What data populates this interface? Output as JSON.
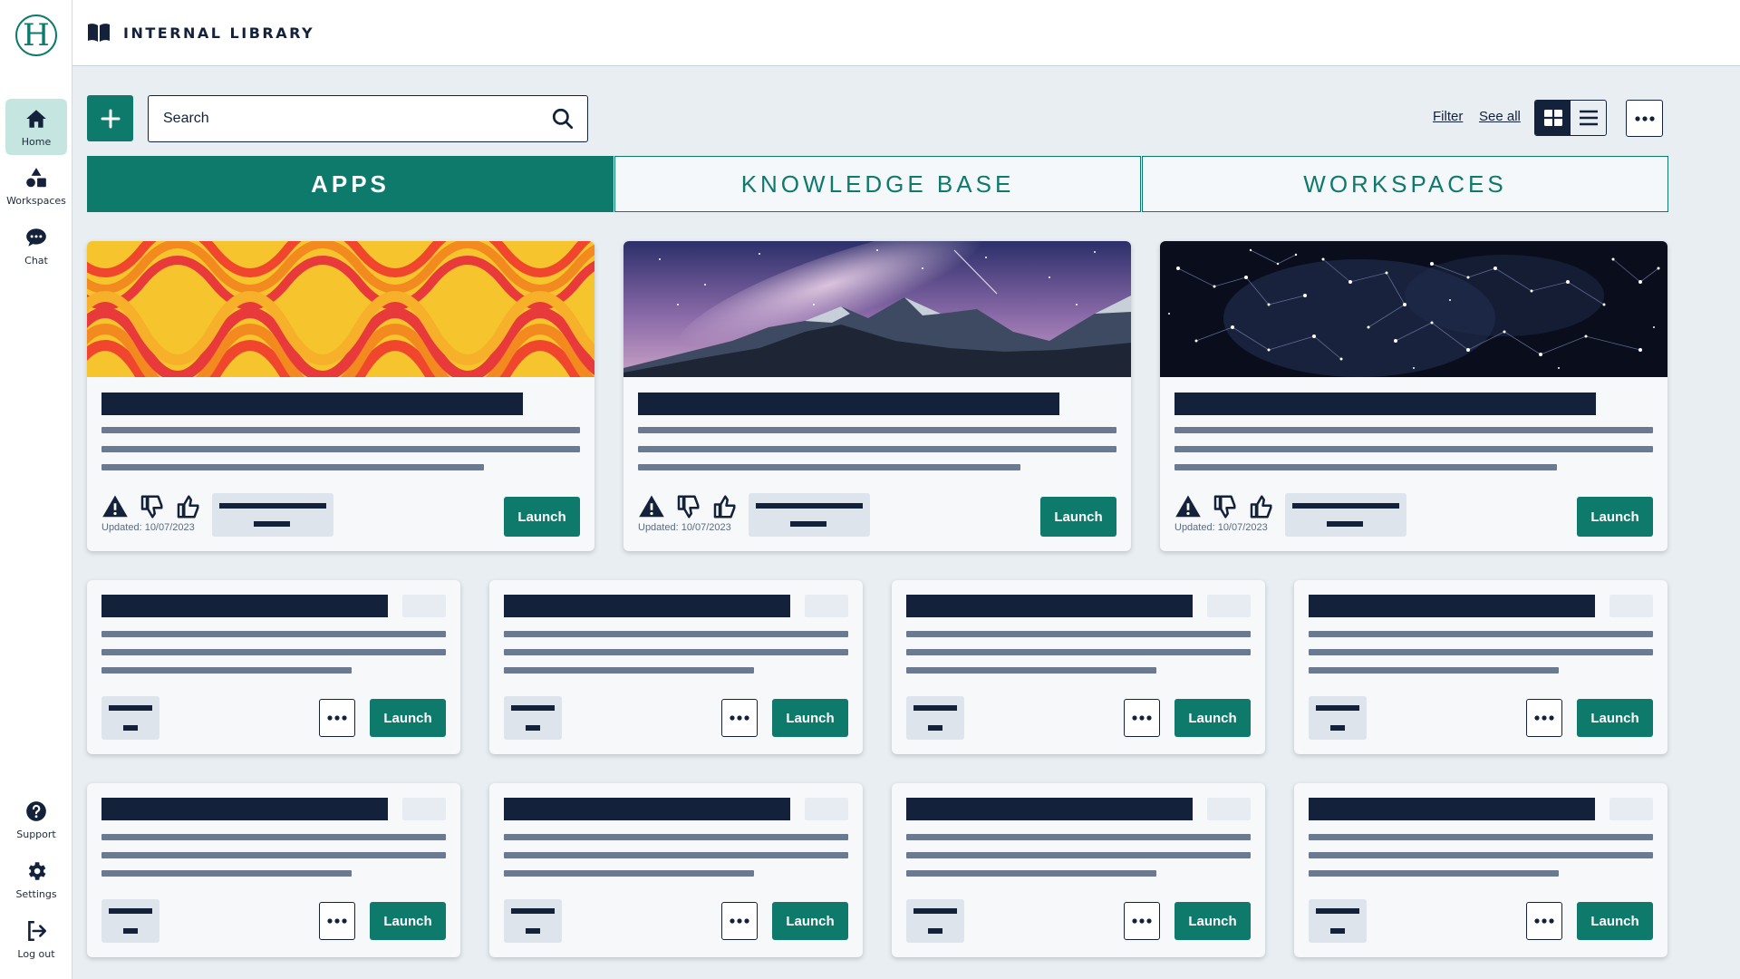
{
  "sidebar": {
    "logo_letter": "H",
    "items": [
      {
        "label": "Home",
        "icon": "home-icon"
      },
      {
        "label": "Workspaces",
        "icon": "shapes-icon"
      },
      {
        "label": "Chat",
        "icon": "chat-icon"
      }
    ],
    "bottom_items": [
      {
        "label": "Support",
        "icon": "help-icon"
      },
      {
        "label": "Settings",
        "icon": "gear-icon"
      },
      {
        "label": "Log out",
        "icon": "logout-icon"
      }
    ]
  },
  "header": {
    "title": "INTERNAL LIBRARY",
    "icon": "book-icon"
  },
  "toolbar": {
    "search_placeholder": "Search",
    "filter_label": "Filter",
    "see_all_label": "See all",
    "view_mode": "grid"
  },
  "tabs": [
    {
      "label": "APPS",
      "active": true
    },
    {
      "label": "KNOWLEDGE BASE",
      "active": false
    },
    {
      "label": "WORKSPACES",
      "active": false
    }
  ],
  "featured_cards": [
    {
      "image": "retro-wave-pattern",
      "updated": "Updated: 10/07/2023",
      "launch_label": "Launch"
    },
    {
      "image": "milky-way-mountains",
      "updated": "Updated: 10/07/2023",
      "launch_label": "Launch"
    },
    {
      "image": "constellation-star-map",
      "updated": "Updated: 10/07/2023",
      "launch_label": "Launch"
    }
  ],
  "small_cards": [
    {
      "launch_label": "Launch"
    },
    {
      "launch_label": "Launch"
    },
    {
      "launch_label": "Launch"
    },
    {
      "launch_label": "Launch"
    },
    {
      "launch_label": "Launch"
    },
    {
      "launch_label": "Launch"
    },
    {
      "launch_label": "Launch"
    },
    {
      "launch_label": "Launch"
    }
  ],
  "colors": {
    "brand": "#0d7a6c",
    "ink": "#14213a",
    "background": "#e9eef3",
    "active_nav": "#c5e6e0"
  }
}
